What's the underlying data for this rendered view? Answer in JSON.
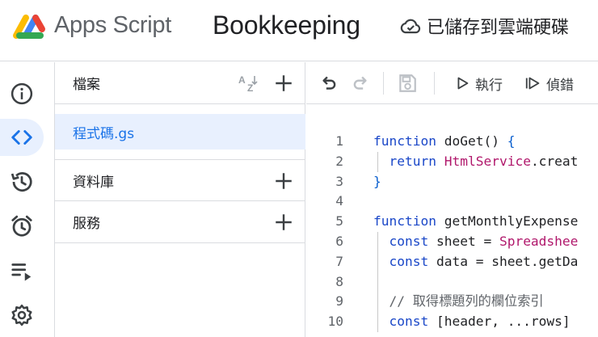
{
  "header": {
    "app_name": "Apps Script",
    "project_name": "Bookkeeping",
    "save_status": "已儲存到雲端硬碟"
  },
  "rail": {
    "items": [
      {
        "icon": "info-icon",
        "active": false
      },
      {
        "icon": "code-icon",
        "active": true
      },
      {
        "icon": "history-icon",
        "active": false
      },
      {
        "icon": "alarm-icon",
        "active": false
      },
      {
        "icon": "executions-icon",
        "active": false
      },
      {
        "icon": "settings-icon",
        "active": false
      }
    ]
  },
  "panel": {
    "files_label": "檔案",
    "file_item": "程式碼.gs",
    "libraries_label": "資料庫",
    "services_label": "服務"
  },
  "toolbar": {
    "run_label": "執行",
    "debug_label": "偵錯"
  },
  "code": {
    "lines": [
      {
        "n": "1",
        "parts": [
          {
            "t": "function",
            "c": "kw"
          },
          {
            "t": " doGet() "
          },
          {
            "t": "{",
            "c": "brk"
          }
        ]
      },
      {
        "n": "2",
        "guide": true,
        "parts": [
          {
            "t": "  "
          },
          {
            "t": "return",
            "c": "kw"
          },
          {
            "t": " "
          },
          {
            "t": "HtmlService",
            "c": "cls"
          },
          {
            "t": ".creat"
          }
        ]
      },
      {
        "n": "3",
        "parts": [
          {
            "t": "}",
            "c": "brk"
          }
        ]
      },
      {
        "n": "4",
        "parts": []
      },
      {
        "n": "5",
        "parts": [
          {
            "t": "function",
            "c": "kw"
          },
          {
            "t": " getMonthlyExpense"
          }
        ]
      },
      {
        "n": "6",
        "guide": true,
        "parts": [
          {
            "t": "  "
          },
          {
            "t": "const",
            "c": "kw"
          },
          {
            "t": " sheet = "
          },
          {
            "t": "Spreadshee",
            "c": "cls"
          }
        ]
      },
      {
        "n": "7",
        "guide": true,
        "parts": [
          {
            "t": "  "
          },
          {
            "t": "const",
            "c": "kw"
          },
          {
            "t": " data = sheet.getDa"
          }
        ]
      },
      {
        "n": "8",
        "guide": true,
        "parts": []
      },
      {
        "n": "9",
        "guide": true,
        "parts": [
          {
            "t": "  "
          },
          {
            "t": "// 取得標題列的欄位索引",
            "c": "cmt"
          }
        ]
      },
      {
        "n": "10",
        "guide": true,
        "parts": [
          {
            "t": "  "
          },
          {
            "t": "const",
            "c": "kw"
          },
          {
            "t": " [header, ...rows]"
          }
        ]
      }
    ]
  },
  "colors": {
    "accent": "#1a73e8",
    "active_bg": "#e8f0fe",
    "keyword": "#1a47c8",
    "class_name": "#b0176b",
    "comment": "#5f6368"
  }
}
